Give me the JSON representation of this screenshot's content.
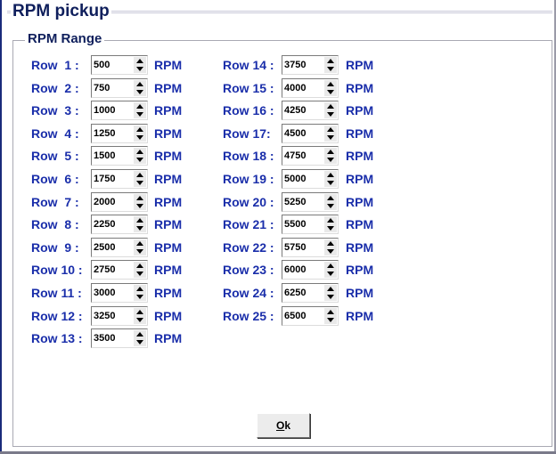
{
  "window": {
    "title": "RPM pickup"
  },
  "group": {
    "title": "RPM Range"
  },
  "unit_label": "RPM",
  "rows": [
    {
      "label": "Row  1 :",
      "value": "500"
    },
    {
      "label": "Row  2 :",
      "value": "750"
    },
    {
      "label": "Row  3 :",
      "value": "1000"
    },
    {
      "label": "Row  4 :",
      "value": "1250"
    },
    {
      "label": "Row  5 :",
      "value": "1500"
    },
    {
      "label": "Row  6 :",
      "value": "1750"
    },
    {
      "label": "Row  7 :",
      "value": "2000"
    },
    {
      "label": "Row  8 :",
      "value": "2250"
    },
    {
      "label": "Row  9 :",
      "value": "2500"
    },
    {
      "label": "Row 10 :",
      "value": "2750"
    },
    {
      "label": "Row 11 :",
      "value": "3000"
    },
    {
      "label": "Row 12 :",
      "value": "3250"
    },
    {
      "label": "Row 13 :",
      "value": "3500"
    },
    {
      "label": "Row 14 :",
      "value": "3750"
    },
    {
      "label": "Row 15 :",
      "value": "4000"
    },
    {
      "label": "Row 16 :",
      "value": "4250"
    },
    {
      "label": "Row 17:",
      "value": "4500"
    },
    {
      "label": "Row 18 :",
      "value": "4750"
    },
    {
      "label": "Row 19 :",
      "value": "5000"
    },
    {
      "label": "Row 20 :",
      "value": "5250"
    },
    {
      "label": "Row 21 :",
      "value": "5500"
    },
    {
      "label": "Row 22 :",
      "value": "5750"
    },
    {
      "label": "Row 23 :",
      "value": "6000"
    },
    {
      "label": "Row 24 :",
      "value": "6250"
    },
    {
      "label": "Row 25 :",
      "value": "6500"
    }
  ],
  "ok_button": {
    "accel": "O",
    "rest": "k"
  },
  "colors": {
    "label_blue": "#1a2eaa",
    "title_navy": "#0f1f5c"
  }
}
